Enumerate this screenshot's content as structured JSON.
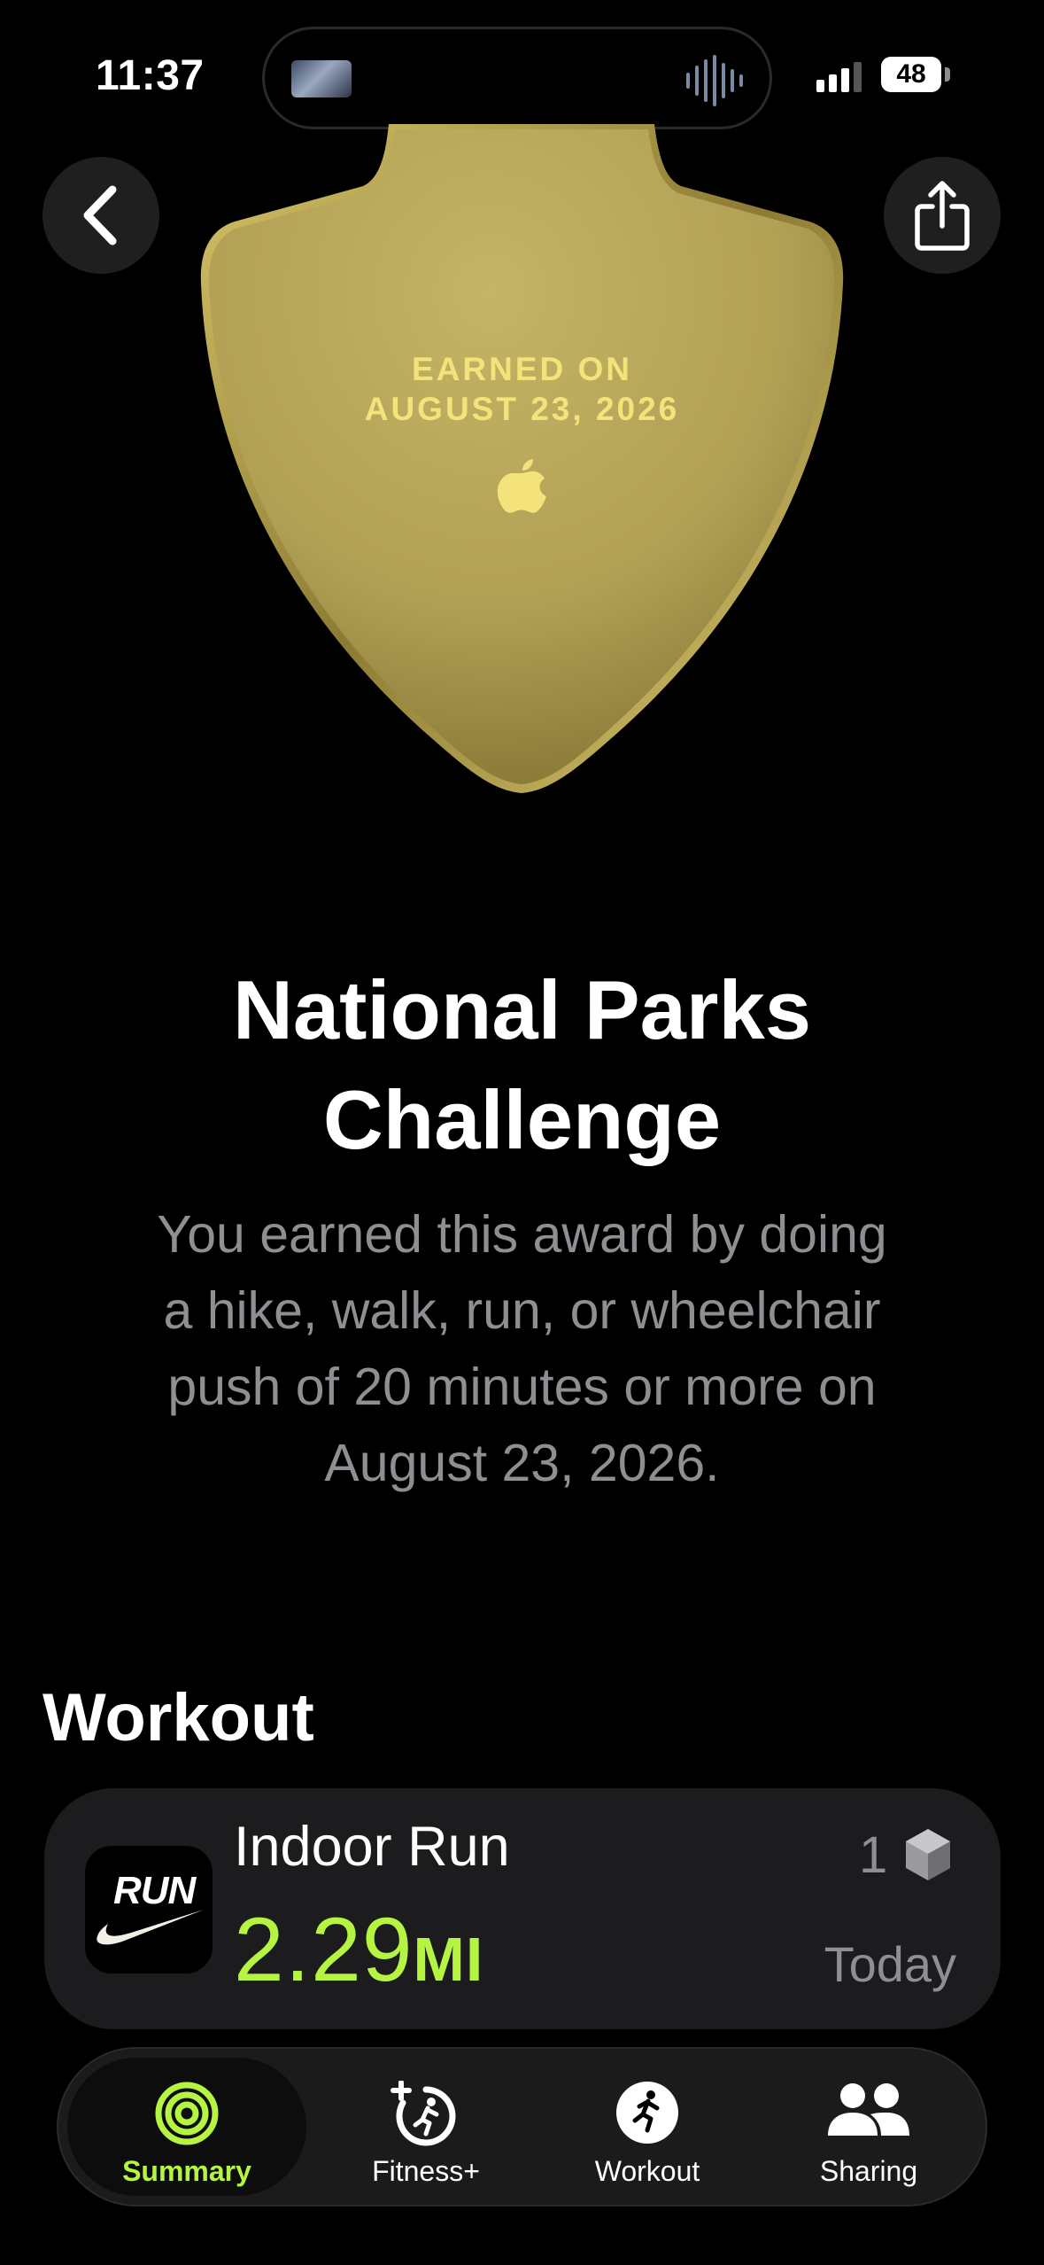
{
  "status_bar": {
    "time": "11:37",
    "battery": "48"
  },
  "header": {
    "back_icon": "chevron-left-icon",
    "share_icon": "share-icon"
  },
  "award": {
    "earned_line1": "EARNED ON",
    "earned_line2": "AUGUST 23, 2026",
    "logo": "apple-logo-icon",
    "title_line1": "National Parks",
    "title_line2": "Challenge",
    "description_lines": [
      "You earned this award by doing",
      "a hike, walk, run, or wheelchair",
      "push of 20 minutes or more on",
      "August 23, 2026."
    ]
  },
  "workout_section": {
    "title": "Workout",
    "item": {
      "app_logo_text": "RUN",
      "name": "Indoor Run",
      "distance_value": "2.29",
      "distance_unit": "MI",
      "count": "1",
      "date": "Today"
    }
  },
  "tab_bar": {
    "tabs": [
      {
        "label": "Summary",
        "icon": "activity-rings-icon",
        "active": true
      },
      {
        "label": "Fitness+",
        "icon": "fitness-plus-icon",
        "active": false
      },
      {
        "label": "Workout",
        "icon": "running-figure-icon",
        "active": false
      },
      {
        "label": "Sharing",
        "icon": "people-icon",
        "active": false
      }
    ]
  },
  "colors": {
    "accent_green": "#b5f542",
    "medal_gold": "#b5a45a",
    "engraving": "#f3e37a",
    "secondary_text": "#8e8e93",
    "card_bg": "#1c1c1e"
  }
}
